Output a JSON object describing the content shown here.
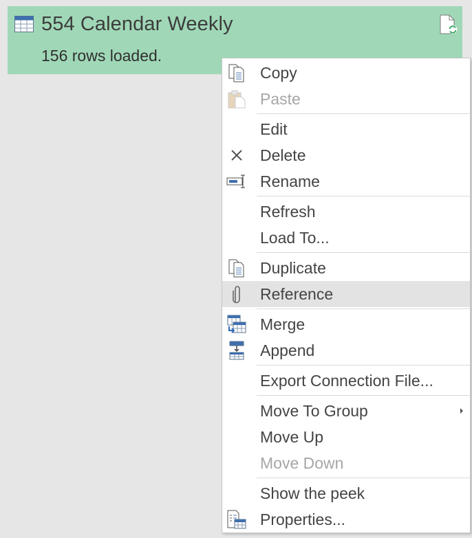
{
  "query": {
    "title": "554 Calendar Weekly",
    "status": "156 rows loaded.",
    "table_icon": "table-icon",
    "refresh_icon": "document-refresh-icon"
  },
  "menu": {
    "items": [
      {
        "label": "Copy",
        "icon": "copy-icon",
        "enabled": true
      },
      {
        "label": "Paste",
        "icon": "paste-icon",
        "enabled": false
      },
      {
        "label": "Edit",
        "icon": null,
        "enabled": true
      },
      {
        "label": "Delete",
        "icon": "delete-icon",
        "enabled": true
      },
      {
        "label": "Rename",
        "icon": "rename-icon",
        "enabled": true
      },
      {
        "label": "Refresh",
        "icon": null,
        "enabled": true
      },
      {
        "label": "Load To...",
        "icon": null,
        "enabled": true
      },
      {
        "label": "Duplicate",
        "icon": "duplicate-icon",
        "enabled": true
      },
      {
        "label": "Reference",
        "icon": "reference-icon",
        "enabled": true,
        "highlighted": true
      },
      {
        "label": "Merge",
        "icon": "merge-icon",
        "enabled": true
      },
      {
        "label": "Append",
        "icon": "append-icon",
        "enabled": true
      },
      {
        "label": "Export Connection File...",
        "icon": null,
        "enabled": true
      },
      {
        "label": "Move To Group",
        "icon": null,
        "enabled": true,
        "submenu": true
      },
      {
        "label": "Move Up",
        "icon": null,
        "enabled": true
      },
      {
        "label": "Move Down",
        "icon": null,
        "enabled": false
      },
      {
        "label": "Show the peek",
        "icon": null,
        "enabled": true
      },
      {
        "label": "Properties...",
        "icon": "properties-icon",
        "enabled": true
      }
    ]
  },
  "colors": {
    "card_background": "#a0d8b7",
    "page_background": "#e6e6e6",
    "menu_background": "#ffffff",
    "highlight": "#e3e3e3",
    "disabled_text": "#a6a6a6",
    "icon_blue": "#4c7ab0"
  }
}
